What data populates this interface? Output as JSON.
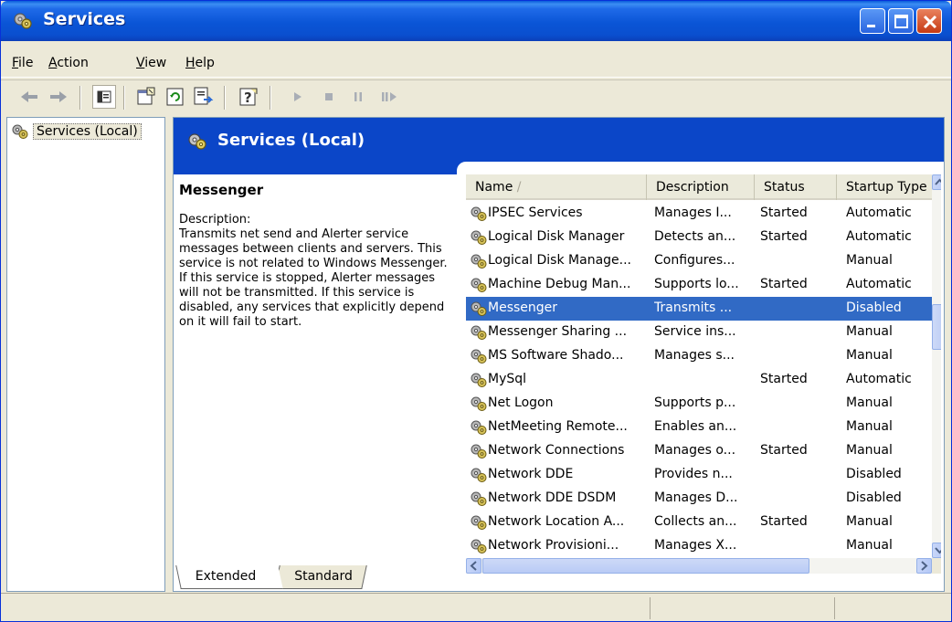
{
  "window": {
    "title": "Services"
  },
  "menu": [
    {
      "label": "File",
      "accel": "F",
      "rest": "ile"
    },
    {
      "label": "Action",
      "accel": "A",
      "rest": "ction"
    },
    {
      "label": "View",
      "accel": "V",
      "rest": "iew"
    },
    {
      "label": "Help",
      "accel": "H",
      "rest": "elp"
    }
  ],
  "tree": {
    "root_label": "Services (Local)"
  },
  "content": {
    "header_title": "Services (Local)",
    "selected_service": "Messenger",
    "description_label": "Description:",
    "description_text": "Transmits net send and Alerter service messages between clients and servers. This service is not related to Windows Messenger. If this service is stopped, Alerter messages will not be transmitted. If this service is disabled, any services that explicitly depend on it will fail to start."
  },
  "list": {
    "columns": [
      "Name",
      "Description",
      "Status",
      "Startup Type"
    ],
    "rows": [
      {
        "name": "IPSEC Services",
        "description": "Manages I...",
        "status": "Started",
        "startup": "Automatic"
      },
      {
        "name": "Logical Disk Manager",
        "description": "Detects an...",
        "status": "Started",
        "startup": "Automatic"
      },
      {
        "name": "Logical Disk Manage...",
        "description": "Configures...",
        "status": "",
        "startup": "Manual"
      },
      {
        "name": "Machine Debug Man...",
        "description": "Supports lo...",
        "status": "Started",
        "startup": "Automatic"
      },
      {
        "name": "Messenger",
        "description": "Transmits ...",
        "status": "",
        "startup": "Disabled",
        "selected": true
      },
      {
        "name": "Messenger Sharing ...",
        "description": "Service ins...",
        "status": "",
        "startup": "Manual"
      },
      {
        "name": "MS Software Shado...",
        "description": "Manages s...",
        "status": "",
        "startup": "Manual"
      },
      {
        "name": "MySql",
        "description": "",
        "status": "Started",
        "startup": "Automatic"
      },
      {
        "name": "Net Logon",
        "description": "Supports p...",
        "status": "",
        "startup": "Manual"
      },
      {
        "name": "NetMeeting Remote...",
        "description": "Enables an...",
        "status": "",
        "startup": "Manual"
      },
      {
        "name": "Network Connections",
        "description": "Manages o...",
        "status": "Started",
        "startup": "Manual"
      },
      {
        "name": "Network DDE",
        "description": "Provides n...",
        "status": "",
        "startup": "Disabled"
      },
      {
        "name": "Network DDE DSDM",
        "description": "Manages D...",
        "status": "",
        "startup": "Disabled"
      },
      {
        "name": "Network Location A...",
        "description": "Collects an...",
        "status": "Started",
        "startup": "Manual"
      },
      {
        "name": "Network Provisioni...",
        "description": "Manages X...",
        "status": "",
        "startup": "Manual"
      }
    ]
  },
  "tabs": {
    "extended": "Extended",
    "standard": "Standard"
  },
  "colors": {
    "title_blue": "#0a55d6",
    "header_blue": "#0b46c8",
    "selection": "#316ac5",
    "chrome": "#ece9d8"
  },
  "icons": [
    "services-gear-icon",
    "back-arrow-icon",
    "forward-arrow-icon",
    "show-hide-tree-icon",
    "properties-icon",
    "refresh-icon",
    "export-list-icon",
    "help-icon",
    "start-service-icon",
    "stop-service-icon",
    "pause-service-icon",
    "restart-service-icon"
  ]
}
